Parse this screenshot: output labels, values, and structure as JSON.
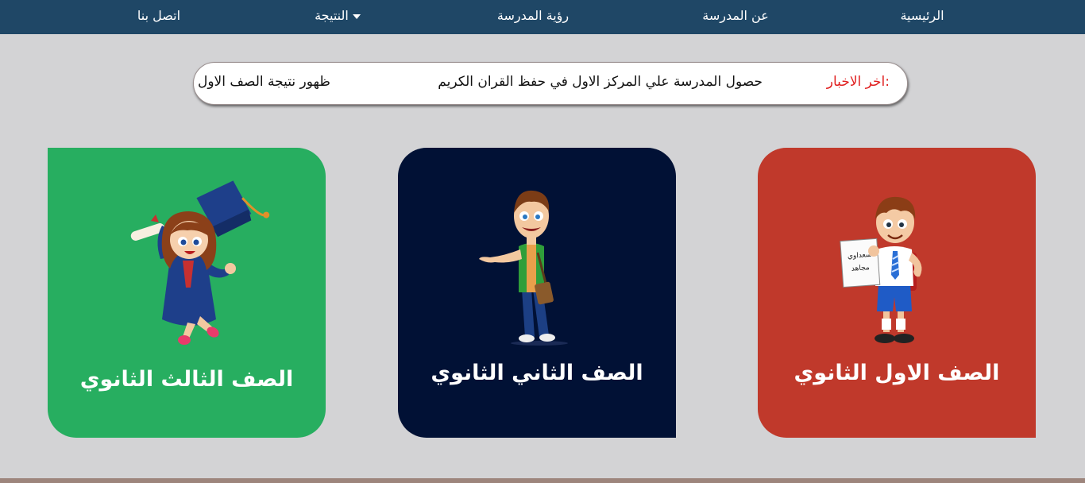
{
  "nav": {
    "home": "الرئيسية",
    "about": "عن المدرسة",
    "vision": "رؤية المدرسة",
    "results": "النتيجة",
    "contact": "اتصل بنا"
  },
  "news": {
    "label": "اخر الاخبار:",
    "items": [
      "حصول المدرسة علي المركز الاول في حفظ القران الكريم",
      "ظهور نتيجة الصف الاول"
    ]
  },
  "cards": [
    {
      "title": "الصف الاول الثانوي",
      "color": "#c0392b",
      "paper_line1": "سعداوي",
      "paper_line2": "مجاهد"
    },
    {
      "title": "الصف الثاني الثانوي",
      "color": "#011135"
    },
    {
      "title": "الصف الثالث الثانوي",
      "color": "#27ae60"
    }
  ],
  "icons": {
    "results_dropdown": "caret-down-icon"
  },
  "colors": {
    "navbar": "#1f4766",
    "background": "#d3d3d5",
    "news_label": "#e01f1f"
  }
}
